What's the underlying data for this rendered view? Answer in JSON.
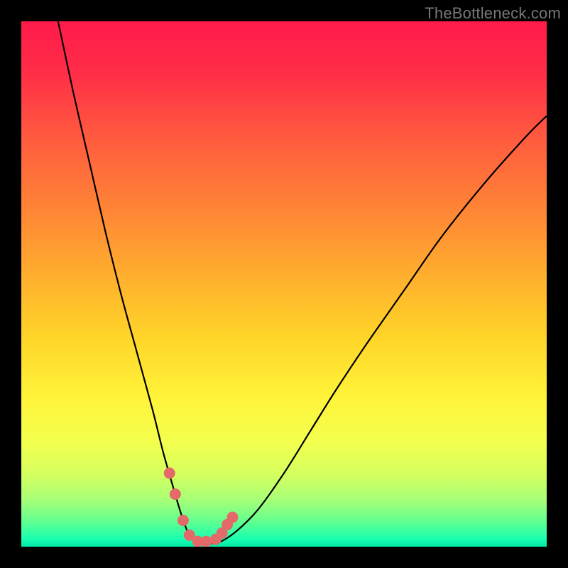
{
  "watermark": "TheBottleneck.com",
  "chart_data": {
    "type": "line",
    "title": "",
    "xlabel": "",
    "ylabel": "",
    "xlim": [
      0,
      100
    ],
    "ylim": [
      0,
      100
    ],
    "grid": false,
    "series": [
      {
        "name": "curve",
        "x": [
          7,
          10,
          13,
          16,
          19,
          22,
          25,
          27,
          29,
          30.5,
          32,
          34,
          36,
          38,
          41,
          45,
          50,
          55,
          60,
          66,
          73,
          80,
          88,
          96,
          100
        ],
        "values": [
          100,
          86,
          73,
          60,
          48,
          37,
          26,
          18,
          11,
          6,
          2.2,
          0.6,
          0.6,
          1.0,
          3.0,
          7,
          14,
          22,
          30,
          39,
          49,
          59,
          69,
          78,
          82
        ]
      }
    ],
    "markers": {
      "name": "dots",
      "x": [
        28.2,
        29.3,
        30.8,
        32.0,
        33.6,
        35.2,
        37.0,
        38.2,
        39.2,
        40.2
      ],
      "values": [
        14.0,
        10.0,
        5.0,
        2.2,
        1.0,
        1.0,
        1.4,
        2.6,
        4.2,
        5.6
      ],
      "color": "#e46a6a",
      "radius": 8
    },
    "gradient": {
      "stops": [
        {
          "offset": 0.0,
          "color": "#ff1a4a"
        },
        {
          "offset": 0.1,
          "color": "#ff2e47"
        },
        {
          "offset": 0.22,
          "color": "#ff5a3f"
        },
        {
          "offset": 0.35,
          "color": "#ff8236"
        },
        {
          "offset": 0.48,
          "color": "#ffad2e"
        },
        {
          "offset": 0.6,
          "color": "#ffd428"
        },
        {
          "offset": 0.72,
          "color": "#fff43a"
        },
        {
          "offset": 0.8,
          "color": "#f3ff4e"
        },
        {
          "offset": 0.86,
          "color": "#d6ff5e"
        },
        {
          "offset": 0.91,
          "color": "#a8ff76"
        },
        {
          "offset": 0.95,
          "color": "#66ff8e"
        },
        {
          "offset": 0.985,
          "color": "#1affb0"
        },
        {
          "offset": 1.0,
          "color": "#00e8a8"
        }
      ]
    }
  }
}
